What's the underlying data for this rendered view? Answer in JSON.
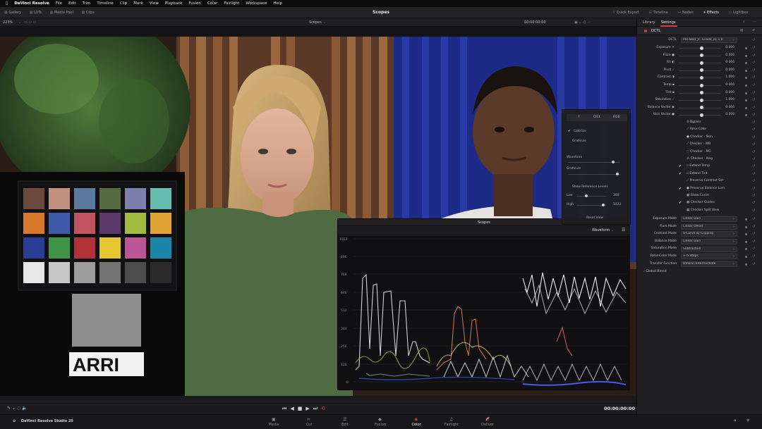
{
  "menubar": {
    "apple": "",
    "app": "DaVinci Resolve",
    "items": [
      "File",
      "Edit",
      "Trim",
      "Timeline",
      "Clip",
      "Mark",
      "View",
      "Playback",
      "Fusion",
      "Color",
      "Fairlight",
      "Workspace",
      "Help"
    ]
  },
  "toolbar": {
    "left_tabs": [
      "Gallery",
      "LUTs",
      "Media Pool",
      "Clips"
    ],
    "title": "Scopes",
    "right_tabs": [
      "Quick Export",
      "Timeline",
      "Nodes",
      "Effects",
      "Lightbox"
    ]
  },
  "subbar": {
    "zoom": "223%",
    "viewer_label": "Scopes",
    "timecode": "00:00:00:00"
  },
  "right_panel": {
    "tabs": [
      "Library",
      "Settings"
    ],
    "active_tab": "Settings",
    "effect_name": "DCTL",
    "dctl_label": "DCTL",
    "dctl_value": "PeeToolz_P...Grade_v1.1.0",
    "params": [
      {
        "label": "Exposure",
        "icon": "☀",
        "value": "0.000"
      },
      {
        "label": "Flare",
        "icon": "●",
        "value": "0.000"
      },
      {
        "label": "Fill",
        "icon": "◐",
        "value": "0.000"
      },
      {
        "label": "Pivot",
        "icon": "⟋",
        "value": "0.000"
      },
      {
        "label": "Contrast",
        "icon": "◑",
        "value": "1.000"
      },
      {
        "label": "Temp",
        "icon": "▪",
        "value": "0.000"
      },
      {
        "label": "Tint",
        "icon": "▪",
        "value": "0.000"
      },
      {
        "label": "Saturation",
        "icon": "⟋",
        "value": "1.000"
      },
      {
        "label": "Balance Vector",
        "icon": "◉",
        "value": "0.000"
      },
      {
        "label": "Skin Vector",
        "icon": "●",
        "value": "0.000"
      }
    ],
    "options": [
      {
        "label": "Bypass",
        "checked": false,
        "icon": "⊘"
      },
      {
        "label": "False Color",
        "checked": false,
        "icon": "⟋"
      },
      {
        "label": "Checker - Skin",
        "checked": false,
        "icon": "●"
      },
      {
        "label": "Checker - WB",
        "checked": false,
        "icon": "⟋"
      },
      {
        "label": "Checker - MG",
        "checked": false,
        "icon": "◌"
      },
      {
        "label": "Checker - Neg",
        "checked": false,
        "icon": "⁂"
      },
      {
        "label": "Extend Temp",
        "checked": true,
        "icon": "▫"
      },
      {
        "label": "Extend Tint",
        "checked": true,
        "icon": "▫"
      },
      {
        "label": "Preserve Contrast Sat",
        "checked": false,
        "icon": "⟋"
      },
      {
        "label": "Preserve Balance Lum",
        "checked": true,
        "icon": "●"
      },
      {
        "label": "Show Curve",
        "checked": false,
        "icon": "▦"
      },
      {
        "label": "Checker Guides",
        "checked": true,
        "icon": "▦"
      },
      {
        "label": "Checker Split View",
        "checked": false,
        "icon": "▦"
      }
    ],
    "dropdowns": [
      {
        "label": "Exposure Mode",
        "value": "Linear Gain"
      },
      {
        "label": "Flare Mode",
        "value": "Linear Offset"
      },
      {
        "label": "Contrast Mode",
        "value": "S-Curve w/ Clipping"
      },
      {
        "label": "Balance Mode",
        "value": "Linear Gain"
      },
      {
        "label": "Saturation Mode",
        "value": "Subtractive"
      },
      {
        "label": "False Color Mode",
        "value": "+-5 Stops"
      },
      {
        "label": "Transfer Function",
        "value": "DaVinci Intermediate"
      }
    ],
    "global_blend": "Global Blend"
  },
  "scope_settings": {
    "tabs": [
      "Y",
      "CIE1",
      "RGB"
    ],
    "colorize": "Colorize",
    "graticule_label": "Graticule",
    "waveform_label": "Waveform",
    "graticule2_label": "Graticule",
    "show_ref": "Show Reference Levels",
    "low_label": "Low",
    "low_value": "300",
    "high_label": "High",
    "high_value": "1023",
    "reset": "Reset View"
  },
  "scopes": {
    "title": "Scopes",
    "mode": "Waveform",
    "y_ticks": [
      "1023",
      "896",
      "768",
      "640",
      "512",
      "384",
      "256",
      "128",
      "0"
    ]
  },
  "chart": {
    "logo_text": "ARRI"
  },
  "transport": {
    "timecode": "00:00:00:00"
  },
  "pagebar": {
    "app_name": "DaVinci Resolve Studio 20",
    "pages": [
      "Media",
      "Cut",
      "Edit",
      "Fusion",
      "Color",
      "Fairlight",
      "Deliver"
    ],
    "page_icons": [
      "▣",
      "✂",
      "☰",
      "◆",
      "◉",
      "♫",
      "🚀"
    ],
    "active": "Color"
  },
  "colors": {
    "accent": "#e0384b",
    "panel": "#202023"
  }
}
